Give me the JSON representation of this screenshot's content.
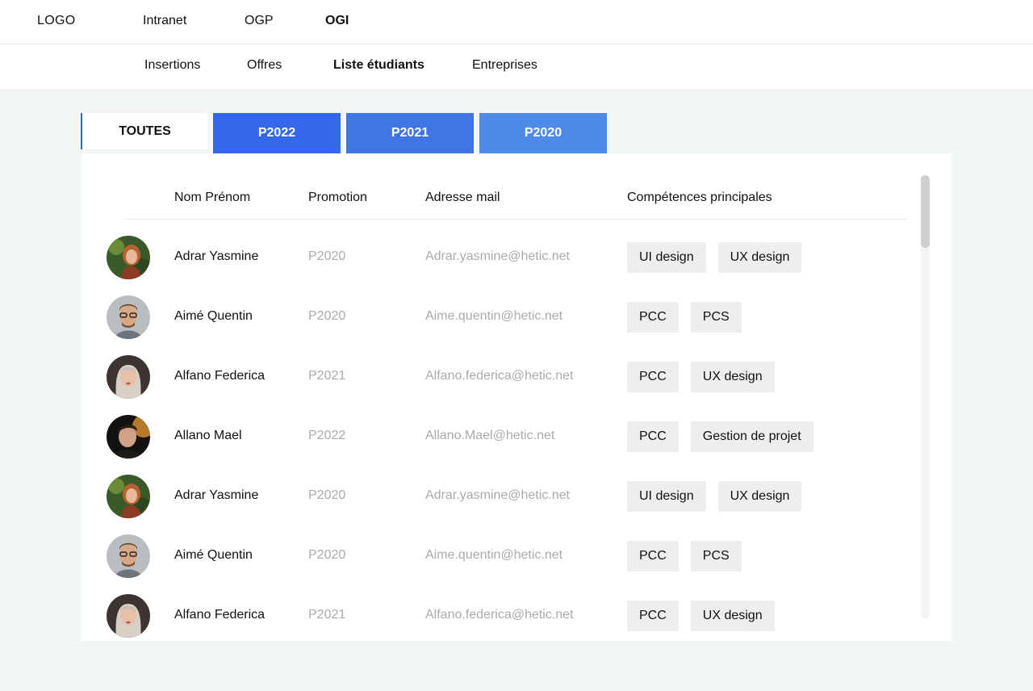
{
  "brand": {
    "logo_text": "LOGO"
  },
  "top_nav": {
    "items": [
      {
        "label": "Intranet"
      },
      {
        "label": "OGP"
      },
      {
        "label": "OGI"
      }
    ],
    "active": "OGI"
  },
  "sub_nav": {
    "items": [
      {
        "label": "Insertions"
      },
      {
        "label": "Offres"
      },
      {
        "label": "Liste étudiants"
      },
      {
        "label": "Entreprises"
      }
    ],
    "active": "Liste étudiants"
  },
  "tabs": {
    "items": [
      {
        "label": "TOUTES"
      },
      {
        "label": "P2022"
      },
      {
        "label": "P2021"
      },
      {
        "label": "P2020"
      }
    ],
    "active": "TOUTES"
  },
  "table": {
    "headers": {
      "name": "Nom Prénom",
      "promotion": "Promotion",
      "email": "Adresse mail",
      "skills": "Compétences principales"
    },
    "rows": [
      {
        "name": "Adrar Yasmine",
        "promotion": "P2020",
        "email": "Adrar.yasmine@hetic.net",
        "skills": [
          "UI design",
          "UX design"
        ]
      },
      {
        "name": "Aimé Quentin",
        "promotion": "P2020",
        "email": "Aime.quentin@hetic.net",
        "skills": [
          "PCC",
          "PCS"
        ]
      },
      {
        "name": "Alfano Federica",
        "promotion": "P2021",
        "email": "Alfano.federica@hetic.net",
        "skills": [
          "PCC",
          "UX design"
        ]
      },
      {
        "name": "Allano Mael",
        "promotion": "P2022",
        "email": "Allano.Mael@hetic.net",
        "skills": [
          "PCC",
          "Gestion de projet"
        ]
      },
      {
        "name": "Adrar Yasmine",
        "promotion": "P2020",
        "email": "Adrar.yasmine@hetic.net",
        "skills": [
          "UI design",
          "UX design"
        ]
      },
      {
        "name": "Aimé Quentin",
        "promotion": "P2020",
        "email": "Aime.quentin@hetic.net",
        "skills": [
          "PCC",
          "PCS"
        ]
      },
      {
        "name": "Alfano Federica",
        "promotion": "P2021",
        "email": "Alfano.federica@hetic.net",
        "skills": [
          "PCC",
          "UX design"
        ]
      }
    ]
  },
  "colors": {
    "page_bg": "#f3f6f7",
    "tab_p2022": "#3468e8",
    "tab_p2021": "#4075e3",
    "tab_p2020": "#4f8ae9",
    "chip_bg": "#eeeeee",
    "muted_text": "#a8abad"
  }
}
